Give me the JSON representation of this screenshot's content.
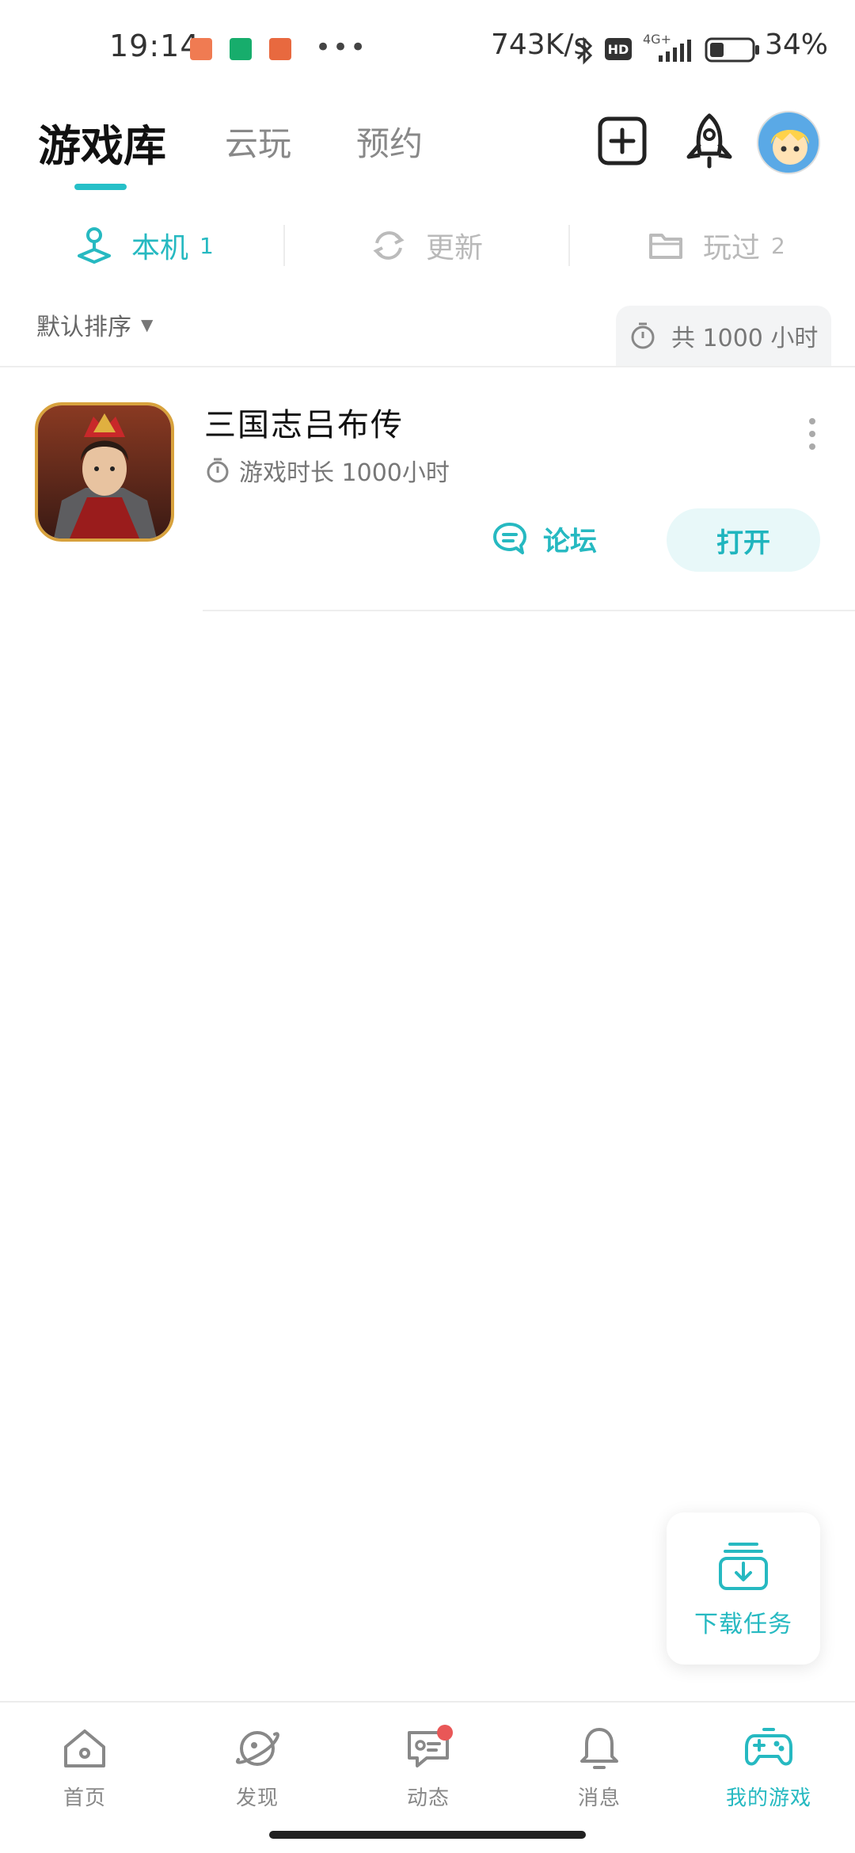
{
  "status_bar": {
    "time": "19:14",
    "dots": "•••",
    "net_speed": "743K/s",
    "hd_label": "HD",
    "network_type": "4G+",
    "battery": "34%"
  },
  "header": {
    "tabs": [
      {
        "label": "游戏库",
        "active": true
      },
      {
        "label": "云玩",
        "active": false
      },
      {
        "label": "预约",
        "active": false
      }
    ],
    "add_icon": "plus-square-icon",
    "rocket_icon": "rocket-icon"
  },
  "subtabs": [
    {
      "label": "本机",
      "count": "1",
      "icon": "joystick-icon",
      "active": true
    },
    {
      "label": "更新",
      "count": "",
      "icon": "refresh-icon",
      "active": false
    },
    {
      "label": "玩过",
      "count": "2",
      "icon": "folder-icon",
      "active": false
    }
  ],
  "sort": {
    "label": "默认排序",
    "total_time": "共 1000 小时"
  },
  "games": [
    {
      "title": "三国志吕布传",
      "play_time": "游戏时长 1000小时",
      "forum_label": "论坛",
      "open_label": "打开"
    }
  ],
  "fab": {
    "label": "下载任务"
  },
  "bottom_nav": [
    {
      "label": "首页",
      "icon": "home-icon",
      "active": false
    },
    {
      "label": "发现",
      "icon": "planet-icon",
      "active": false
    },
    {
      "label": "动态",
      "icon": "chat-icon",
      "active": false,
      "badge": true
    },
    {
      "label": "消息",
      "icon": "bell-icon",
      "active": false
    },
    {
      "label": "我的游戏",
      "icon": "gamepad-icon",
      "active": true
    }
  ],
  "colors": {
    "accent": "#26b9c1",
    "open_bg": "#e8f8f9",
    "badge": "#e95757"
  }
}
